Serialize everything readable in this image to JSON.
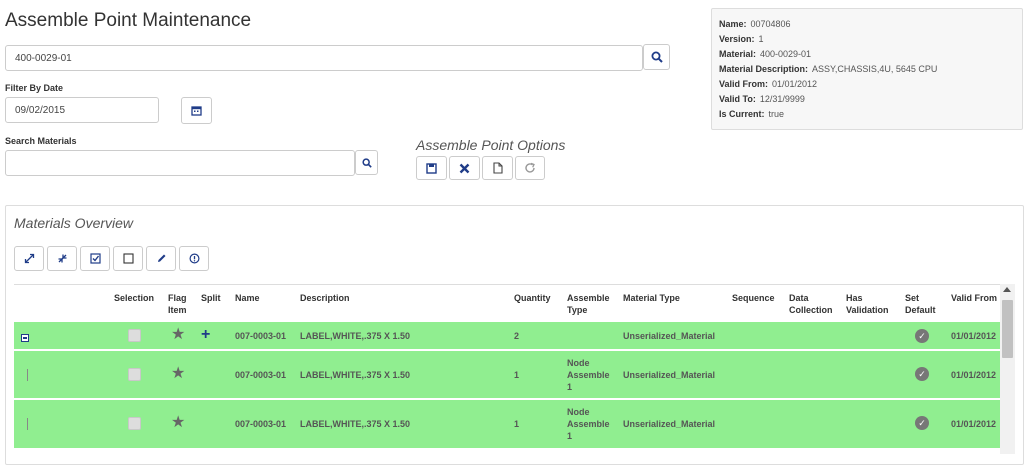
{
  "page": {
    "title": "Assemble Point Maintenance"
  },
  "search": {
    "value": "400-0029-01"
  },
  "filter": {
    "label": "Filter By Date",
    "value": "09/02/2015"
  },
  "materials_search": {
    "label": "Search Materials",
    "value": ""
  },
  "options": {
    "title": "Assemble Point Options"
  },
  "info": {
    "name_label": "Name:",
    "name": "00704806",
    "version_label": "Version:",
    "version": "1",
    "material_label": "Material:",
    "material": "400-0029-01",
    "desc_label": "Material Description:",
    "desc": "ASSY,CHASSIS,4U, 5645 CPU",
    "valid_from_label": "Valid From:",
    "valid_from": "01/01/2012",
    "valid_to_label": "Valid To:",
    "valid_to": "12/31/9999",
    "is_current_label": "Is Current:",
    "is_current": "true"
  },
  "overview": {
    "title": "Materials Overview"
  },
  "grid": {
    "columns": {
      "selection": "Selection",
      "flag1": "Flag",
      "flag2": "Item",
      "split": "Split",
      "name": "Name",
      "description": "Description",
      "quantity": "Quantity",
      "assemble1": "Assemble",
      "assemble2": "Type",
      "material_type": "Material Type",
      "sequence": "Sequence",
      "data1": "Data",
      "data2": "Collection",
      "val1": "Has",
      "val2": "Validation",
      "def1": "Set",
      "def2": "Default",
      "valid_from": "Valid From"
    },
    "rows": [
      {
        "name": "007-0003-01",
        "description": "LABEL,WHITE,.375 X 1.50",
        "quantity": "2",
        "assemble_type": "",
        "material_type": "Unserialized_Material",
        "valid_from": "01/01/2012"
      },
      {
        "name": "007-0003-01",
        "description": "LABEL,WHITE,.375 X 1.50",
        "quantity": "1",
        "assemble_type_1": "Node",
        "assemble_type_2": "Assemble",
        "assemble_type_3": "1",
        "material_type": "Unserialized_Material",
        "valid_from": "01/01/2012"
      },
      {
        "name": "007-0003-01",
        "description": "LABEL,WHITE,.375 X 1.50",
        "quantity": "1",
        "assemble_type_1": "Node",
        "assemble_type_2": "Assemble",
        "assemble_type_3": "1",
        "material_type": "Unserialized_Material",
        "valid_from": "01/01/2012"
      }
    ]
  },
  "colors": {
    "row_green": "#90ee90",
    "accent": "#1f3c88"
  }
}
